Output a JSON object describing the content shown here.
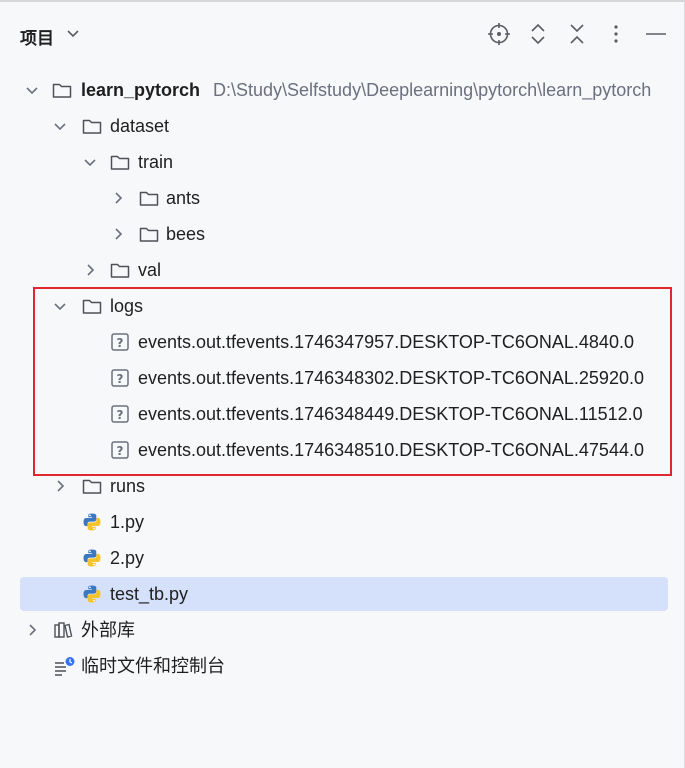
{
  "header": {
    "title": "项目",
    "actions": [
      "locate-icon",
      "expand-icon",
      "collapse-icon",
      "more-icon",
      "minimize-icon"
    ]
  },
  "tree": {
    "root": {
      "label": "learn_pytorch",
      "path": "D:\\Study\\Selfstudy\\Deeplearning\\pytorch\\learn_pytorch"
    },
    "dataset": "dataset",
    "train": "train",
    "ants": "ants",
    "bees": "bees",
    "val": "val",
    "logs": "logs",
    "events": [
      "events.out.tfevents.1746347957.DESKTOP-TC6ONAL.4840.0",
      "events.out.tfevents.1746348302.DESKTOP-TC6ONAL.25920.0",
      "events.out.tfevents.1746348449.DESKTOP-TC6ONAL.11512.0",
      "events.out.tfevents.1746348510.DESKTOP-TC6ONAL.47544.0"
    ],
    "runs": "runs",
    "files": [
      "1.py",
      "2.py",
      "test_tb.py"
    ],
    "external_libs": "外部库",
    "scratches": "临时文件和控制台"
  },
  "colors": {
    "selection": "#d5e1fb",
    "highlight": "#e0262f",
    "path_gray": "#6c707e"
  }
}
